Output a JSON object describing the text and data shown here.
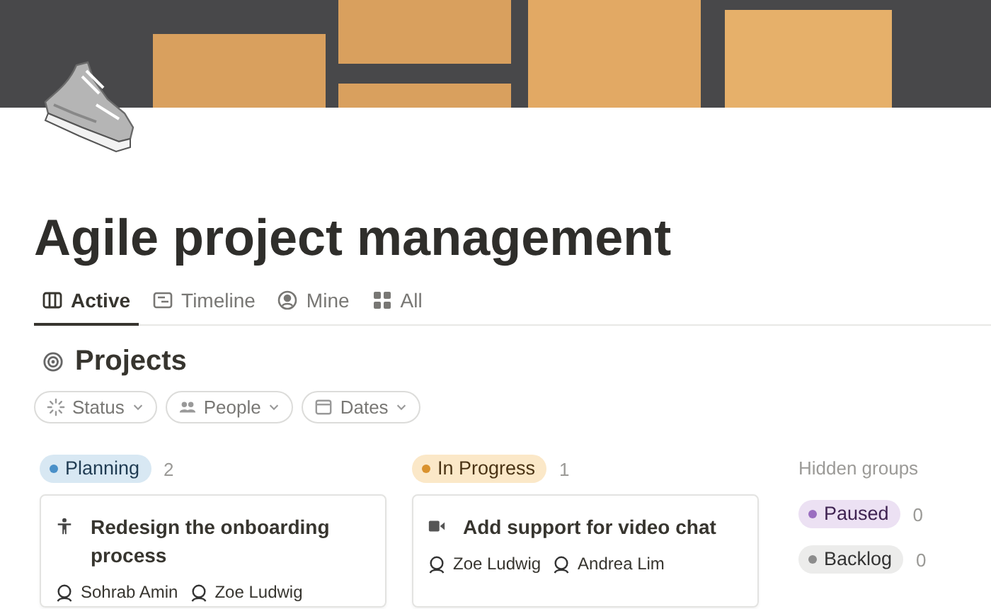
{
  "page": {
    "title": "Agile project management"
  },
  "tabs": [
    {
      "label": "Active",
      "kind": "board",
      "selected": true
    },
    {
      "label": "Timeline",
      "kind": "timeline",
      "selected": false
    },
    {
      "label": "Mine",
      "kind": "person",
      "selected": false
    },
    {
      "label": "All",
      "kind": "grid",
      "selected": false
    }
  ],
  "section": {
    "title": "Projects"
  },
  "filters": [
    {
      "label": "Status",
      "kind": "status"
    },
    {
      "label": "People",
      "kind": "people"
    },
    {
      "label": "Dates",
      "kind": "calendar"
    }
  ],
  "groups": [
    {
      "label": "Planning",
      "count": "2",
      "color": "#4a90c8",
      "cards": [
        {
          "title": "Redesign the onboarding process",
          "kind": "person",
          "people": [
            "Sohrab Amin",
            "Zoe Ludwig"
          ]
        }
      ]
    },
    {
      "label": "In Progress",
      "count": "1",
      "color": "#d9922e",
      "cards": [
        {
          "title": "Add support for video chat",
          "kind": "video",
          "people": [
            "Zoe Ludwig",
            "Andrea Lim"
          ]
        }
      ]
    }
  ],
  "hidden_groups": {
    "title": "Hidden groups",
    "items": [
      {
        "label": "Paused",
        "count": "0",
        "color": "#9a6dc0"
      },
      {
        "label": "Backlog",
        "count": "0",
        "color": "#8c8c8c"
      }
    ]
  }
}
